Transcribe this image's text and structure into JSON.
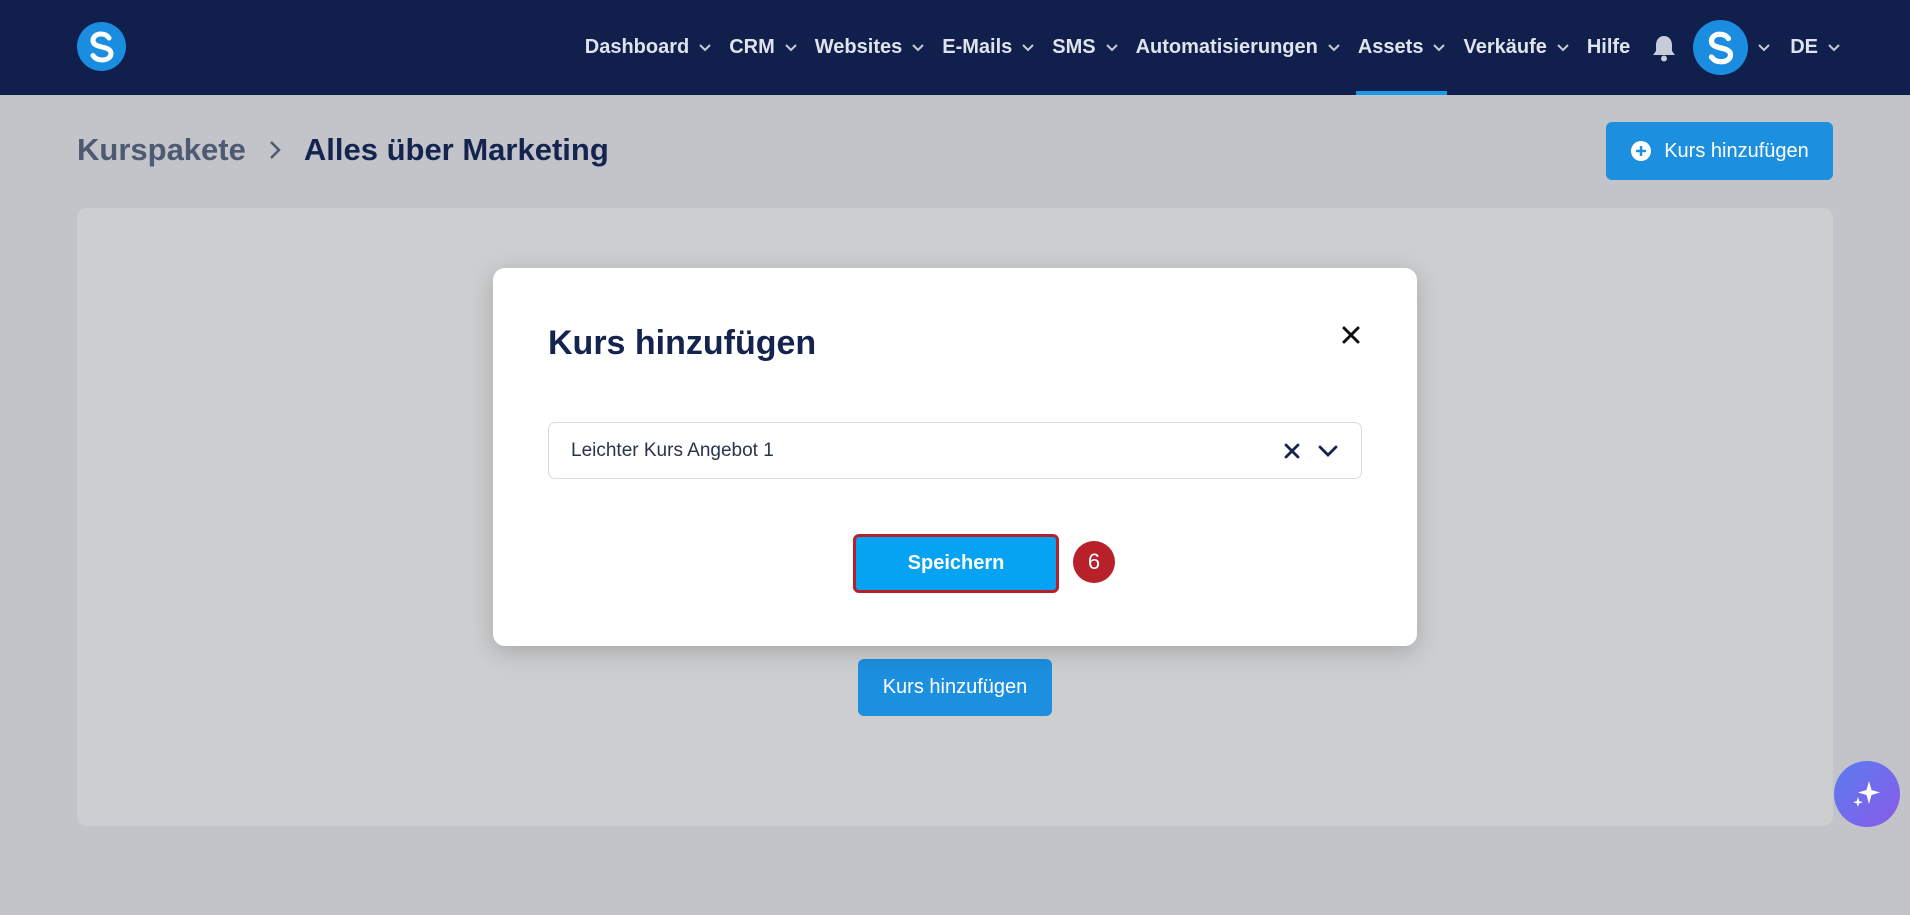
{
  "nav": {
    "items": [
      {
        "label": "Dashboard",
        "has_dropdown": true,
        "active": false
      },
      {
        "label": "CRM",
        "has_dropdown": true,
        "active": false
      },
      {
        "label": "Websites",
        "has_dropdown": true,
        "active": false
      },
      {
        "label": "E-Mails",
        "has_dropdown": true,
        "active": false
      },
      {
        "label": "SMS",
        "has_dropdown": true,
        "active": false
      },
      {
        "label": "Automatisierungen",
        "has_dropdown": true,
        "active": false
      },
      {
        "label": "Assets",
        "has_dropdown": true,
        "active": true
      },
      {
        "label": "Verkäufe",
        "has_dropdown": true,
        "active": false
      },
      {
        "label": "Hilfe",
        "has_dropdown": false,
        "active": false
      }
    ],
    "language": "DE"
  },
  "breadcrumb": {
    "root": "Kurspakete",
    "current": "Alles über Marketing"
  },
  "header": {
    "add_course_label": "Kurs hinzufügen"
  },
  "card": {
    "add_course_label": "Kurs hinzufügen"
  },
  "modal": {
    "title": "Kurs hinzufügen",
    "select_value": "Leichter Kurs Angebot 1",
    "save_label": "Speichern",
    "step_number": "6"
  },
  "colors": {
    "nav_bg": "#111f4c",
    "primary": "#1c8fdf",
    "save_button": "#05a3f2",
    "highlight": "#b8202a"
  }
}
